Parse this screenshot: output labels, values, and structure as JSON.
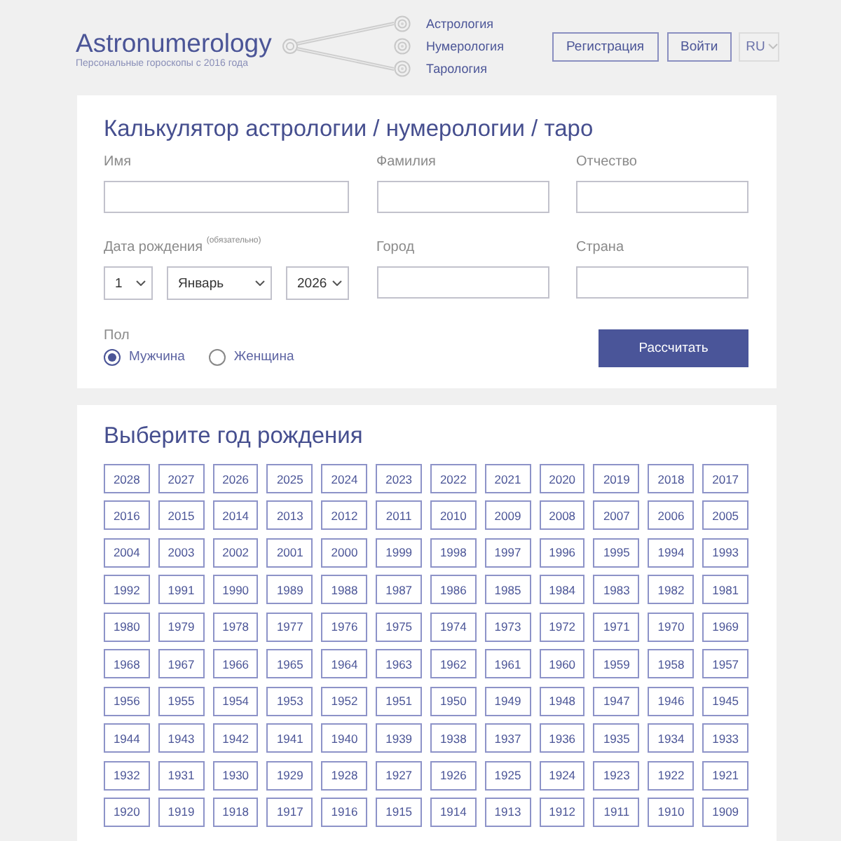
{
  "header": {
    "logo": "Astronumerology",
    "tagline": "Персональные гороскопы с 2016 года",
    "nav": [
      {
        "label": "Астрология"
      },
      {
        "label": "Нумерология"
      },
      {
        "label": "Тарология"
      }
    ],
    "buttons": [
      "Регистрация",
      "Войти"
    ],
    "language": "RU"
  },
  "calculator": {
    "title": "Калькулятор астрологии / нумерологии / таро",
    "fields": [
      {
        "kind": "text",
        "label": "Имя"
      },
      {
        "kind": "text",
        "label": "Фамилия"
      },
      {
        "kind": "text",
        "label": "Отчество"
      },
      {
        "kind": "date",
        "label": "Дата рождения $^{(обязательно)}$",
        "selects": [
          {
            "kind": "day",
            "value": "1"
          },
          {
            "kind": "month",
            "value": "Январь"
          },
          {
            "kind": "year",
            "value": "2026"
          }
        ]
      },
      {
        "kind": "text",
        "label": "Город"
      },
      {
        "kind": "text",
        "label": "Страна"
      }
    ],
    "gender": {
      "label": "Пол",
      "options": [
        {
          "label": "Мужчина",
          "selected": true
        },
        {
          "label": "Женщина",
          "selected": false
        }
      ]
    },
    "submit": "Рассчитать"
  },
  "year_picker": {
    "title": "Выберите год рождения",
    "years": [
      "2028",
      "2027",
      "2026",
      "2025",
      "2024",
      "2023",
      "2022",
      "2021",
      "2020",
      "2019",
      "2018",
      "2017",
      "2016",
      "2015",
      "2014",
      "2013",
      "2012",
      "2011",
      "2010",
      "2009",
      "2008",
      "2007",
      "2006",
      "2005",
      "2004",
      "2003",
      "2002",
      "2001",
      "2000",
      "1999",
      "1998",
      "1997",
      "1996",
      "1995",
      "1994",
      "1993",
      "1992",
      "1991",
      "1990",
      "1989",
      "1988",
      "1987",
      "1986",
      "1985",
      "1984",
      "1983",
      "1982",
      "1981",
      "1980",
      "1979",
      "1978",
      "1977",
      "1976",
      "1975",
      "1974",
      "1973",
      "1972",
      "1971",
      "1970",
      "1969",
      "1968",
      "1967",
      "1966",
      "1965",
      "1964",
      "1963",
      "1962",
      "1961",
      "1960",
      "1959",
      "1958",
      "1957",
      "1956",
      "1955",
      "1954",
      "1953",
      "1952",
      "1951",
      "1950",
      "1949",
      "1948",
      "1947",
      "1946",
      "1945",
      "1944",
      "1943",
      "1942",
      "1941",
      "1940",
      "1939",
      "1938",
      "1937",
      "1936",
      "1935",
      "1934",
      "1933",
      "1932",
      "1931",
      "1930",
      "1929",
      "1928",
      "1927",
      "1926",
      "1925",
      "1924",
      "1923",
      "1922",
      "1921",
      "1920",
      "1919",
      "1918",
      "1917",
      "1916",
      "1915",
      "1914",
      "1913",
      "1912",
      "1911",
      "1910",
      "1909"
    ]
  }
}
